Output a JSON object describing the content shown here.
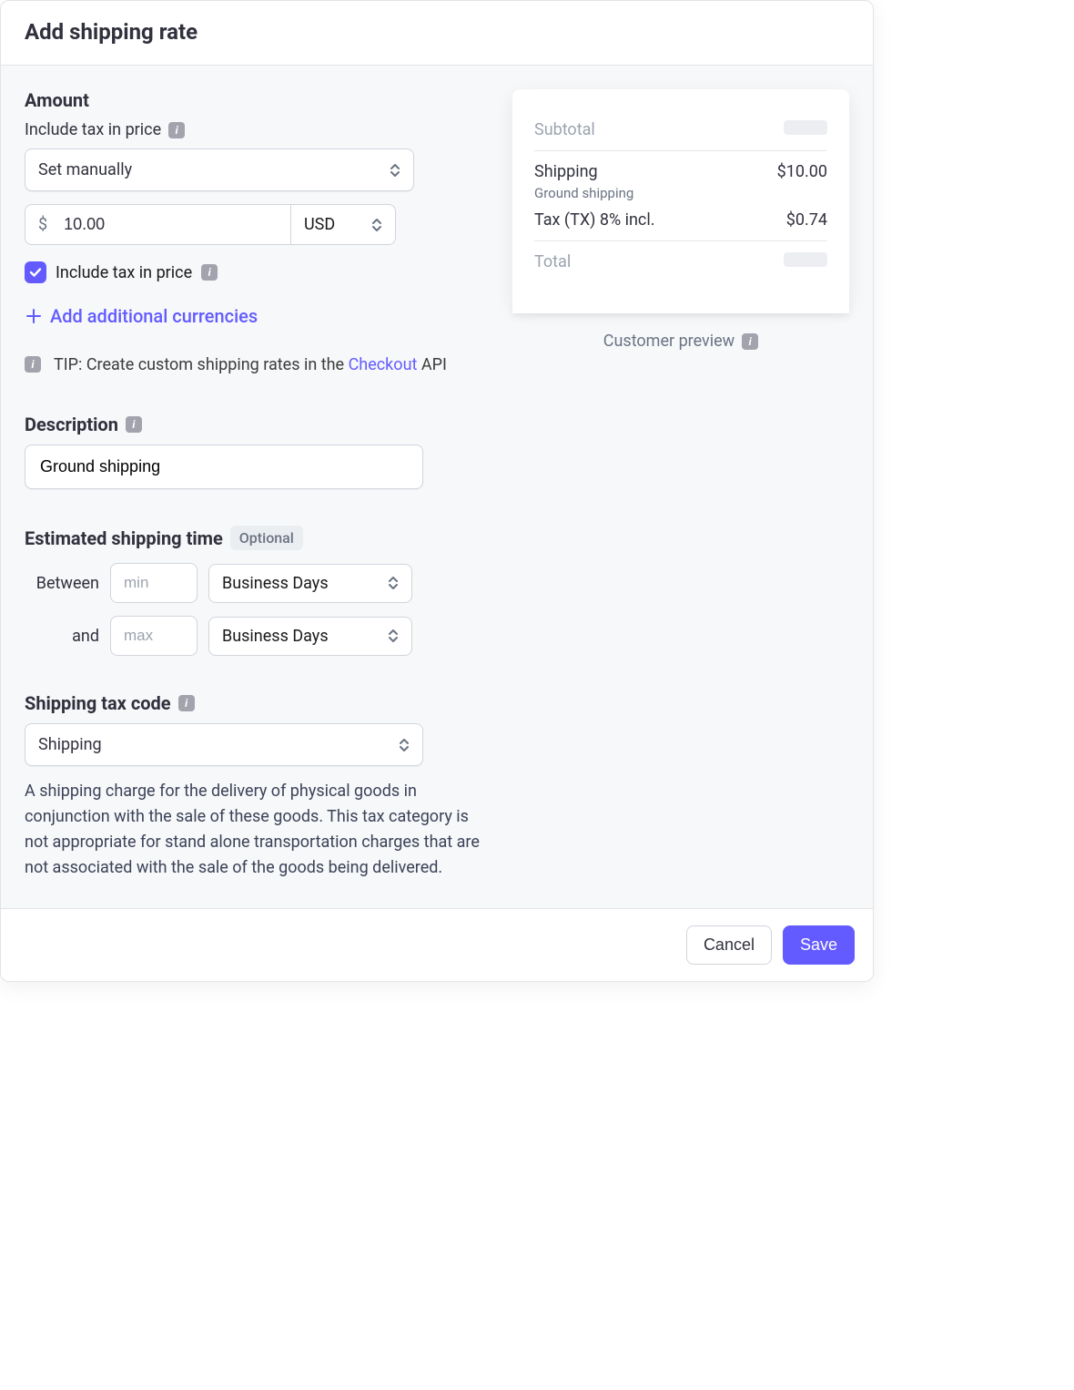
{
  "title": "Add shipping rate",
  "amount": {
    "heading": "Amount",
    "include_tax_label": "Include tax in price",
    "method_select": "Set manually",
    "currency_symbol": "$",
    "price_value": "10.00",
    "currency_code": "USD",
    "include_tax_checkbox_label": "Include tax in price",
    "include_tax_checked": true,
    "add_currencies": "Add additional currencies",
    "tip_prefix": "TIP: Create custom shipping rates in the",
    "tip_link": "Checkout",
    "tip_suffix": " API"
  },
  "description": {
    "heading": "Description",
    "value": "Ground shipping"
  },
  "est": {
    "heading": "Estimated shipping time",
    "optional": "Optional",
    "between": "Between",
    "and": "and",
    "min_placeholder": "min",
    "max_placeholder": "max",
    "unit": "Business Days"
  },
  "tax_code": {
    "heading": "Shipping tax code",
    "value": "Shipping",
    "help": "A shipping charge for the delivery of physical goods in conjunction with the sale of these goods. This tax category is not appropriate for stand alone transportation charges that are not associated with the sale of the goods being delivered."
  },
  "preview": {
    "subtotal_label": "Subtotal",
    "shipping_label": "Shipping",
    "shipping_sub": "Ground shipping",
    "shipping_value": "$10.00",
    "tax_label": "Tax (TX) 8% incl.",
    "tax_value": "$0.74",
    "total_label": "Total",
    "caption": "Customer preview"
  },
  "footer": {
    "cancel": "Cancel",
    "save": "Save"
  }
}
